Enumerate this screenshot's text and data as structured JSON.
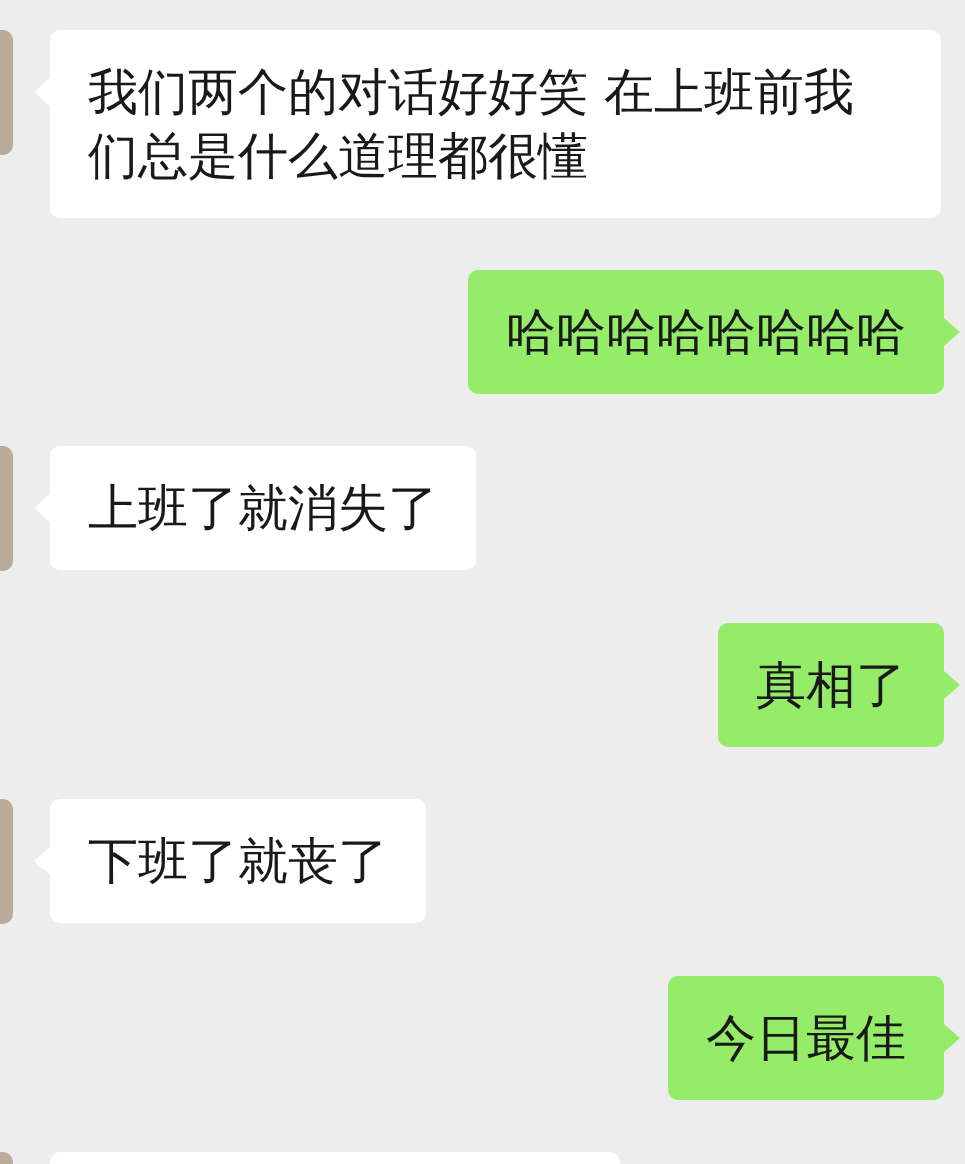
{
  "messages": [
    {
      "kind": "received",
      "text": "我们两个的对话好好笑 在上班前我们总是什么道理都很懂"
    },
    {
      "kind": "sent",
      "text": "哈哈哈哈哈哈哈哈"
    },
    {
      "kind": "received",
      "text": "上班了就消失了"
    },
    {
      "kind": "sent",
      "text": "真相了"
    },
    {
      "kind": "received",
      "text": "下班了就丧了"
    },
    {
      "kind": "sent",
      "text": "今日最佳"
    }
  ],
  "partial_message": {
    "kind": "received"
  }
}
